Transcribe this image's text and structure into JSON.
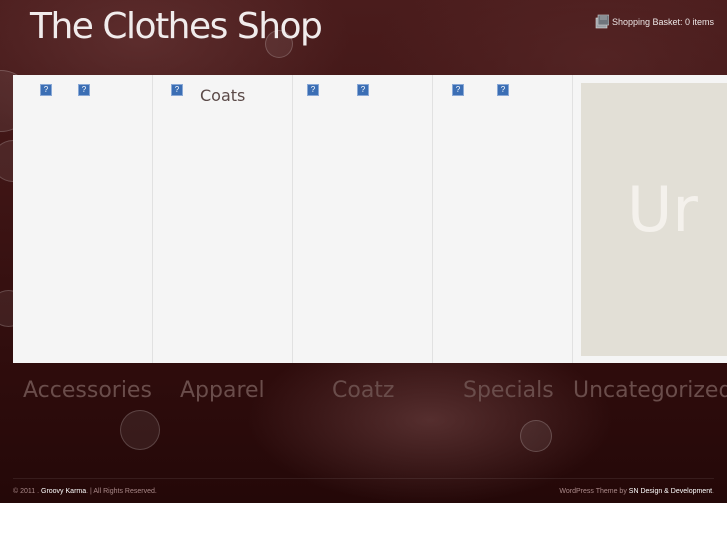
{
  "header": {
    "site_title": "The Clothes Shop",
    "basket_label": "Shopping Basket: 0 items",
    "basket_icon": "shopping-basket-icon"
  },
  "panel": {
    "columns": [
      {
        "title": ""
      },
      {
        "title": "Coats"
      },
      {
        "title": ""
      },
      {
        "title": ""
      }
    ],
    "feature_text": "Ur",
    "broken_image_icon": "broken-image-icon"
  },
  "categories": [
    "Accessories",
    "Apparel",
    "Coatz",
    "Specials",
    "Uncategorized"
  ],
  "footer": {
    "copyright_prefix": "© 2011 .",
    "company": "Groovy Karma",
    "rights": ". | All Rights Reserved.",
    "theme_prefix": "WordPress Theme by",
    "designer": "SN Design & Development",
    "theme_suffix": "."
  },
  "colors": {
    "background": "#3d1414",
    "panel": "#f5f5f5",
    "feature_box": "#e2dfd6",
    "category_text": "#6a4d4b"
  }
}
